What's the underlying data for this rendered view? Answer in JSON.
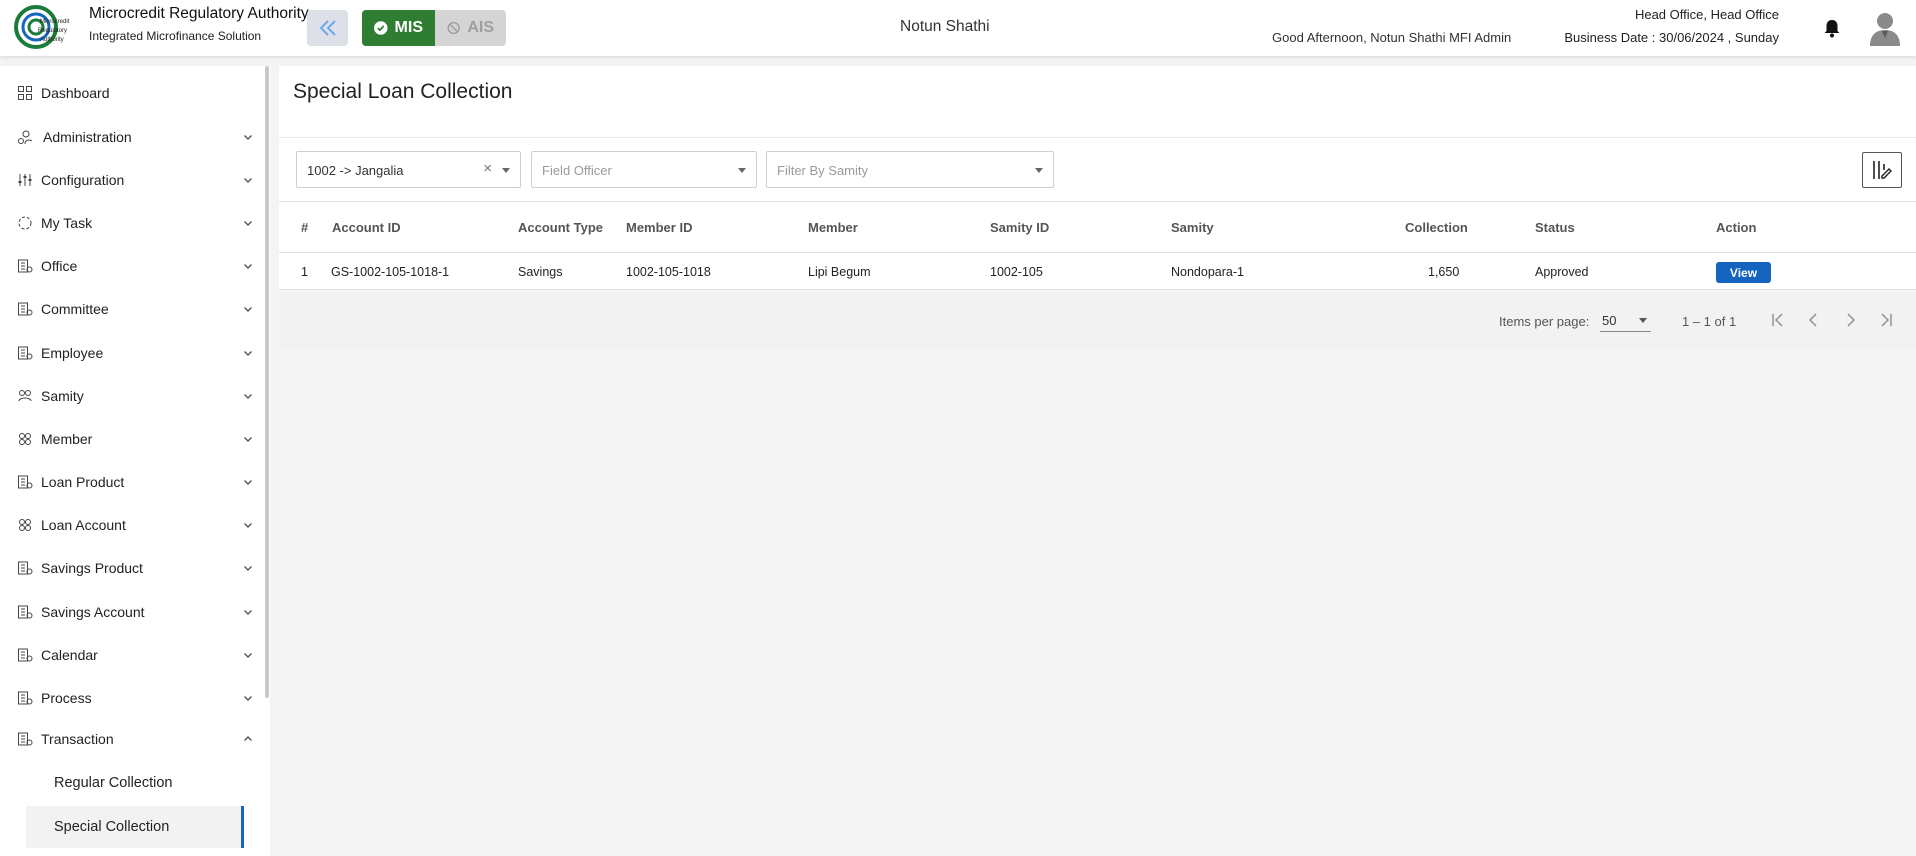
{
  "header": {
    "brand_title": "Microcredit Regulatory Authority",
    "brand_subtitle": "Integrated Microfinance Solution",
    "logo_text": "Microcredit Regulatory Authority",
    "mode_mis": "MIS",
    "mode_ais": "AIS",
    "org_name": "Notun Shathi",
    "greeting": "Good Afternoon, Notun Shathi MFI Admin",
    "branch": "Head Office, Head Office",
    "business_date": "Business Date : 30/06/2024 , Sunday",
    "accent_color": "#2e7d32"
  },
  "sidebar": {
    "items": [
      {
        "label": "Dashboard",
        "icon": "grid-icon"
      },
      {
        "label": "Administration",
        "icon": "admin-icon"
      },
      {
        "label": "Configuration",
        "icon": "sliders-icon"
      },
      {
        "label": "My Task",
        "icon": "task-icon"
      },
      {
        "label": "Office",
        "icon": "building-icon"
      },
      {
        "label": "Committee",
        "icon": "building-icon"
      },
      {
        "label": "Employee",
        "icon": "building-icon"
      },
      {
        "label": "Samity",
        "icon": "group-icon"
      },
      {
        "label": "Member",
        "icon": "people-icon"
      },
      {
        "label": "Loan Product",
        "icon": "building-icon"
      },
      {
        "label": "Loan Account",
        "icon": "people-icon"
      },
      {
        "label": "Savings Product",
        "icon": "building-icon"
      },
      {
        "label": "Savings Account",
        "icon": "building-icon"
      },
      {
        "label": "Calendar",
        "icon": "building-icon"
      },
      {
        "label": "Process",
        "icon": "building-icon"
      },
      {
        "label": "Transaction",
        "icon": "building-icon"
      }
    ],
    "sub_items": [
      {
        "label": "Regular Collection"
      },
      {
        "label": "Special Collection"
      }
    ]
  },
  "main": {
    "page_title": "Special Loan Collection",
    "filters": {
      "branch_value": "1002 -> Jangalia",
      "field_officer_placeholder": "Field Officer",
      "samity_placeholder": "Filter By Samity"
    },
    "table": {
      "columns": [
        "#",
        "Account ID",
        "Account Type",
        "Member ID",
        "Member",
        "Samity ID",
        "Samity",
        "Collection",
        "Status",
        "Action"
      ],
      "rows": [
        {
          "no": "1",
          "account_id": "GS-1002-105-1018-1",
          "account_type": "Savings",
          "member_id": "1002-105-1018",
          "member": "Lipi Begum",
          "samity_id": "1002-105",
          "samity": "Nondopara-1",
          "collection": "1,650",
          "status": "Approved",
          "action": "View"
        }
      ]
    },
    "paginator": {
      "items_per_page_label": "Items per page:",
      "page_size": "50",
      "range": "1 – 1 of 1"
    }
  }
}
